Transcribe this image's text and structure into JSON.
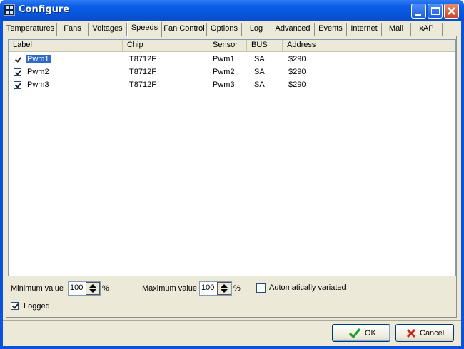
{
  "window": {
    "title": "Configure",
    "title_icon": "fan-app-icon"
  },
  "titlebar_buttons": [
    "minimize-icon",
    "maximize-icon",
    "close-icon"
  ],
  "tabs": [
    "Temperatures",
    "Fans",
    "Voltages",
    "Speeds",
    "Fan Control",
    "Options",
    "Log",
    "Advanced",
    "Events",
    "Internet",
    "Mail",
    "xAP"
  ],
  "active_tab": "Speeds",
  "list": {
    "columns": [
      "Label",
      "Chip",
      "Sensor",
      "BUS",
      "Address"
    ],
    "rows": [
      {
        "checked": true,
        "label": "Pwm1",
        "chip": "IT8712F",
        "sensor": "Pwm1",
        "bus": "ISA",
        "address": "$290",
        "selected": true
      },
      {
        "checked": true,
        "label": "Pwm2",
        "chip": "IT8712F",
        "sensor": "Pwm2",
        "bus": "ISA",
        "address": "$290",
        "selected": false
      },
      {
        "checked": true,
        "label": "Pwm3",
        "chip": "IT8712F",
        "sensor": "Pwm3",
        "bus": "ISA",
        "address": "$290",
        "selected": false
      }
    ]
  },
  "settings": {
    "min_label": "Minimum value",
    "min_value": "100",
    "min_unit": "%",
    "max_label": "Maximum value",
    "max_value": "100",
    "max_unit": "%",
    "auto_label": "Automatically variated",
    "auto_checked": false,
    "logged_label": "Logged",
    "logged_checked": true
  },
  "buttons": {
    "ok": "OK",
    "cancel": "Cancel"
  },
  "colors": {
    "titlebar": "#0b5ce8",
    "selection": "#316ac5",
    "ok_icon": "#1a9b2c",
    "cancel_icon": "#c8281c"
  }
}
